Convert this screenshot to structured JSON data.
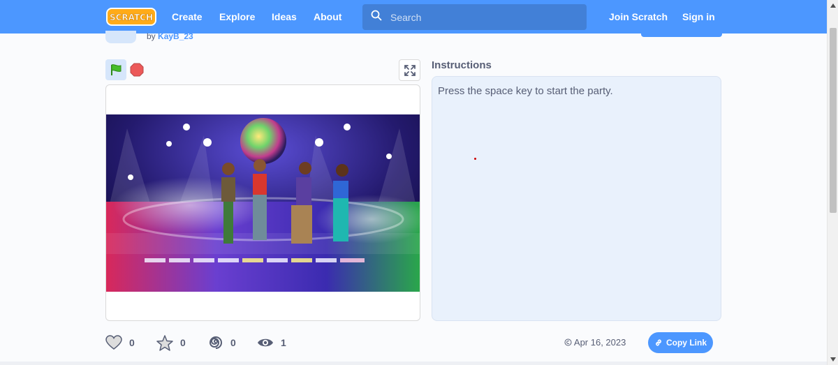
{
  "nav": {
    "logo_text": "SCRATCH",
    "create": "Create",
    "explore": "Explore",
    "ideas": "Ideas",
    "about": "About",
    "search_placeholder": "Search",
    "join": "Join Scratch",
    "signin": "Sign in"
  },
  "project": {
    "by_label": "by",
    "author": "KayB_23"
  },
  "instructions": {
    "title": "Instructions",
    "text": "Press the space key to start the party."
  },
  "stats": {
    "loves": "0",
    "favorites": "0",
    "remixes": "0",
    "views": "1"
  },
  "share": {
    "date": "Apr 16, 2023",
    "copy_link": "Copy Link"
  },
  "colors": {
    "brand": "#4c97ff",
    "search_bg": "#4280d7",
    "instructions_bg": "#e9f1fc",
    "stop_red": "#ec5959",
    "flag_green": "#45bd2a"
  }
}
